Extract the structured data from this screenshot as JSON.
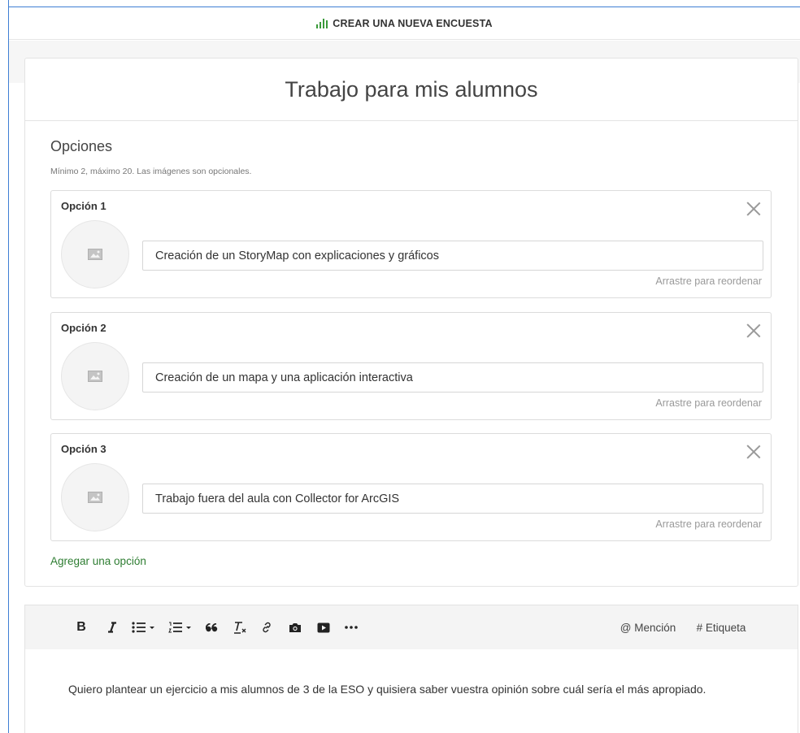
{
  "header": {
    "title": "CREAR UNA NUEVA ENCUESTA",
    "icon": "poll-bars-icon",
    "accent": "#3a9a3a"
  },
  "poll": {
    "title": "Trabajo para mis alumnos",
    "section_title": "Opciones",
    "section_hint": "Mínimo 2, máximo 20. Las imágenes son opcionales.",
    "options": [
      {
        "label": "Opción 1",
        "value": "Creación de un StoryMap con explicaciones y gráficos",
        "drag_hint": "Arrastre para reordenar"
      },
      {
        "label": "Opción 2",
        "value": "Creación de un mapa y una aplicación interactiva",
        "drag_hint": "Arrastre para reordenar"
      },
      {
        "label": "Opción 3",
        "value": "Trabajo fuera del aula con Collector for ArcGIS",
        "drag_hint": "Arrastre para reordenar"
      }
    ],
    "add_option": "Agregar una opción"
  },
  "editor": {
    "toolbar": {
      "bold": "B",
      "mention": "@ Mención",
      "tag": "# Etiqueta",
      "icons": [
        "bold-icon",
        "italic-icon",
        "bullet-list-icon",
        "numbered-list-icon",
        "quote-icon",
        "clear-format-icon",
        "link-icon",
        "camera-icon",
        "video-icon",
        "more-icon"
      ]
    },
    "body": "Quiero plantear un ejercicio a mis alumnos de 3 de la ESO y quisiera saber vuestra opinión sobre cuál sería el más apropiado."
  }
}
